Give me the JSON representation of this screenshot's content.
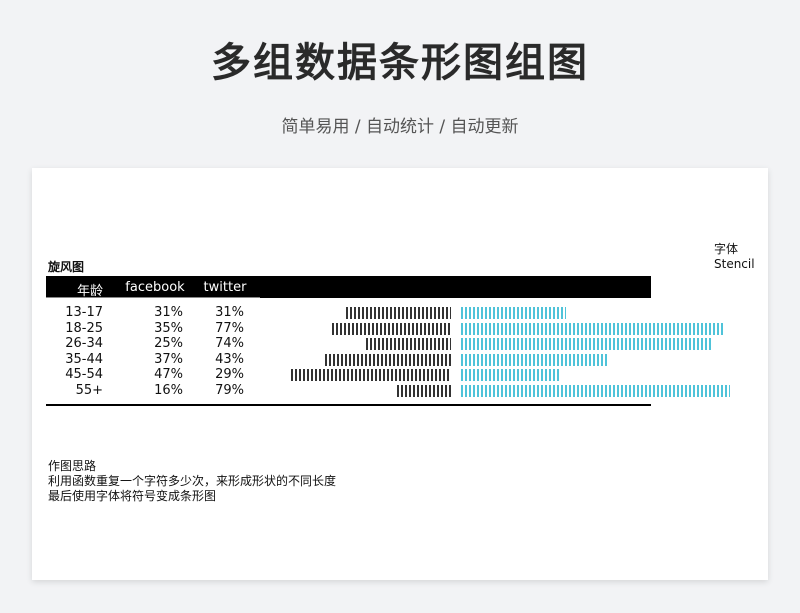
{
  "header": {
    "title": "多组数据条形图组图",
    "subtitle": "简单易用 / 自动统计 / 自动更新"
  },
  "font_note": {
    "label": "字体",
    "font_name": "Stencil"
  },
  "chart_data": {
    "type": "bar",
    "title": "旋风图",
    "columns": [
      "年龄",
      "facebook",
      "twitter"
    ],
    "categories": [
      "13-17",
      "18-25",
      "26-34",
      "35-44",
      "45-54",
      "55+"
    ],
    "facebook_labels": [
      "31%",
      "35%",
      "25%",
      "37%",
      "47%",
      "16%"
    ],
    "twitter_labels": [
      "31%",
      "77%",
      "74%",
      "43%",
      "29%",
      "79%"
    ],
    "series": [
      {
        "name": "facebook",
        "values": [
          31,
          35,
          25,
          37,
          47,
          16
        ],
        "color": "#333333"
      },
      {
        "name": "twitter",
        "values": [
          31,
          77,
          74,
          43,
          29,
          79
        ],
        "color": "#4fc3d9"
      }
    ],
    "xlim": [
      0,
      100
    ]
  },
  "notes": {
    "heading": "作图思路",
    "line1": "利用函数重复一个字符多少次，来形成形状的不同长度",
    "line2": "最后使用字体将符号变成条形图"
  }
}
